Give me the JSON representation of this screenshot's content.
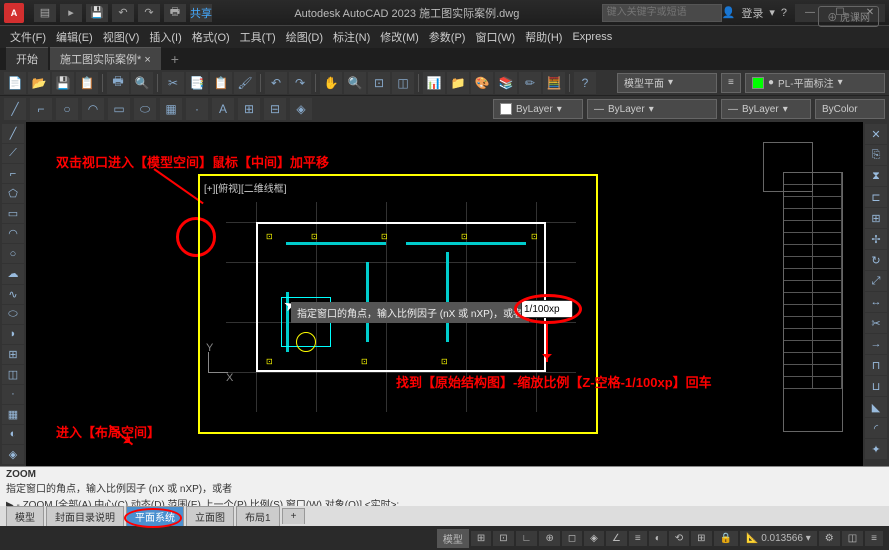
{
  "title": {
    "app": "A",
    "share": "共享",
    "center": "Autodesk AutoCAD 2023   施工图实际案例.dwg",
    "search_ph": "键入关键字或短语",
    "login": "登录"
  },
  "menu": {
    "file": "文件(F)",
    "edit": "编辑(E)",
    "view": "视图(V)",
    "insert": "插入(I)",
    "format": "格式(O)",
    "tools": "工具(T)",
    "draw": "绘图(D)",
    "dim": "标注(N)",
    "modify": "修改(M)",
    "param": "参数(P)",
    "window": "窗口(W)",
    "help": "帮助(H)",
    "express": "Express"
  },
  "tabs": {
    "start": "开始",
    "doc": "施工图实际案例*",
    "add": "+"
  },
  "props": {
    "layer_state": "模型平面",
    "bylayer1": "ByLayer",
    "bylayer2": "ByLayer",
    "bylayer3": "ByLayer",
    "bycolor": "ByColor",
    "pl": "PL-平面标注"
  },
  "viewport": {
    "label": "[+][俯视][二维线框]",
    "tooltip": "指定窗口的角点，输入比例因子 (nX 或 nXP)，或者",
    "zoom_input": "1/100xp",
    "axis_y": "Y",
    "axis_x": "X"
  },
  "annotations": {
    "a1": "双击视口进入【模型空间】鼠标【中间】加平移",
    "a2": "找到【原始结构图】-缩放比例【Z-空格-1/100xp】回车",
    "a3": "进入【布局空间】"
  },
  "cmd": {
    "title": "ZOOM",
    "line1": "指定窗口的角点，输入比例因子 (nX 或 nXP)，或者",
    "line2": "▶ - ZOOM [全部(A) 中心(C) 动态(D) 范围(E) 上一个(P) 比例(S) 窗口(W) 对象(O)] <实时>:"
  },
  "layouts": {
    "model": "模型",
    "l1": "封面目录说明",
    "l2": "平面系统",
    "l3": "立面图",
    "l4": "布局1",
    "add": "+"
  },
  "status": {
    "model": "模型",
    "scale": "0.013566",
    "watermark": "⊕ 虎课网"
  }
}
